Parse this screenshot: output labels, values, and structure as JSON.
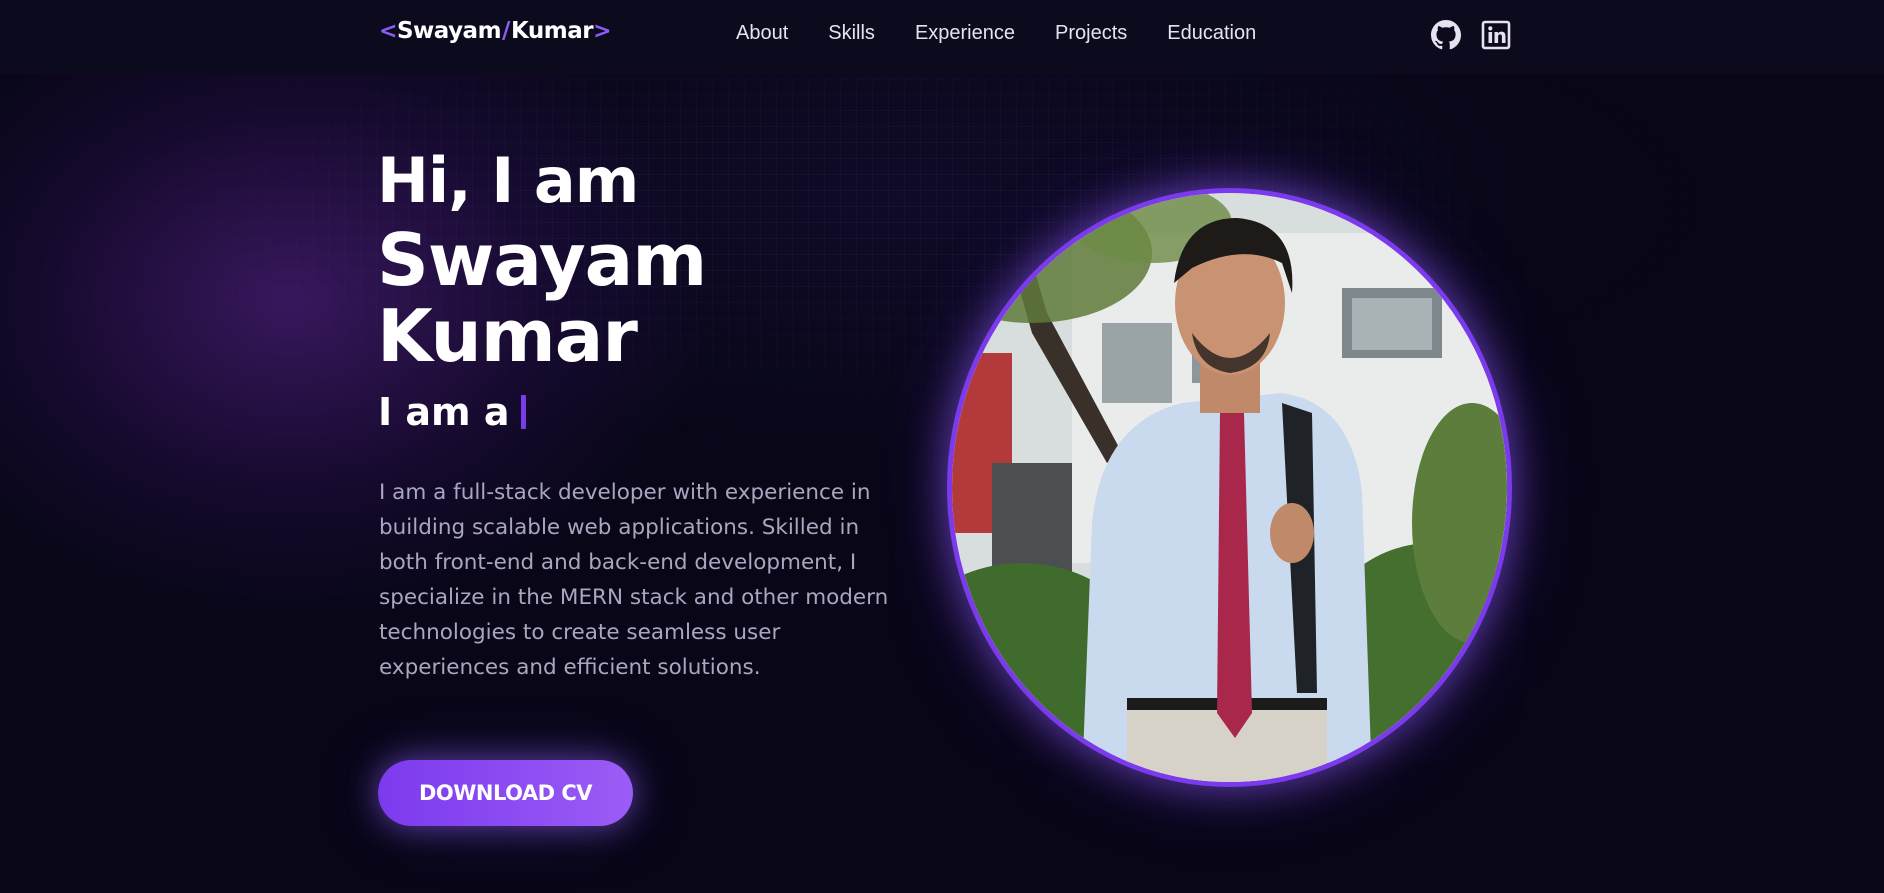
{
  "logo": {
    "open_bracket": "<",
    "first": "Swayam",
    "slash": "/",
    "last": "Kumar",
    "close_bracket": ">"
  },
  "nav": {
    "links": [
      "About",
      "Skills",
      "Experience",
      "Projects",
      "Education"
    ]
  },
  "social": {
    "icons": [
      "github-icon",
      "linkedin-icon"
    ]
  },
  "hero": {
    "greeting": "Hi, I am",
    "name": "Swayam Kumar",
    "typing_prefix": "I am a",
    "description": "I am a full-stack developer with experience in building scalable web applications. Skilled in both front-end and back-end development, I specialize in the MERN stack and other modern technologies to create seamless user experiences and efficient solutions.",
    "cta_label": "DOWNLOAD CV"
  },
  "colors": {
    "background": "#080617",
    "accent": "#7c3aed",
    "accent_light": "#9b5cf6",
    "text_muted": "#a9a6c0"
  }
}
